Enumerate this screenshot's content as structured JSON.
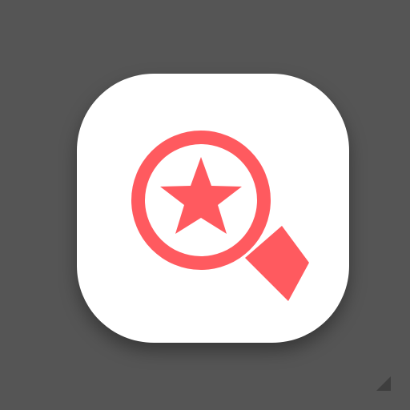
{
  "app_icon": {
    "icon": "magnifier-star-icon",
    "tile_color": "#ffffff",
    "accent_color": "#ff5a5f",
    "background_color": "#555555"
  }
}
